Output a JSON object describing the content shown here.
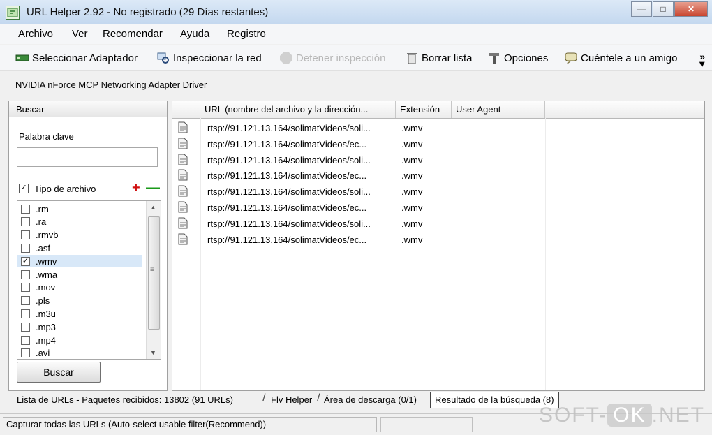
{
  "window": {
    "title": "URL Helper 2.92 - No registrado (29 Días restantes)"
  },
  "menu": [
    "Archivo",
    "Ver",
    "Recomendar",
    "Ayuda",
    "Registro"
  ],
  "toolbar": {
    "select_adapter": "Seleccionar Adaptador",
    "inspect_network": "Inspeccionar la red",
    "stop_inspection": "Detener inspección",
    "clear_list": "Borrar lista",
    "options": "Opciones",
    "tell_friend": "Cuéntele a un amigo"
  },
  "adapter": "NVIDIA nForce MCP Networking Adapter Driver",
  "search_panel": {
    "title": "Buscar",
    "keyword_label": "Palabra clave",
    "keyword_value": "",
    "filetype_label": "Tipo de archivo",
    "filetype_checked": true,
    "extensions": [
      {
        "name": ".rm",
        "checked": false
      },
      {
        "name": ".ra",
        "checked": false
      },
      {
        "name": ".rmvb",
        "checked": false
      },
      {
        "name": ".asf",
        "checked": false
      },
      {
        "name": ".wmv",
        "checked": true
      },
      {
        "name": ".wma",
        "checked": false
      },
      {
        "name": ".mov",
        "checked": false
      },
      {
        "name": ".pls",
        "checked": false
      },
      {
        "name": ".m3u",
        "checked": false
      },
      {
        "name": ".mp3",
        "checked": false
      },
      {
        "name": ".mp4",
        "checked": false
      },
      {
        "name": ".avi",
        "checked": false
      }
    ],
    "search_button": "Buscar"
  },
  "grid": {
    "columns": [
      "URL (nombre del archivo y la dirección...",
      "Extensión",
      "User Agent"
    ],
    "rows": [
      {
        "url": "rtsp://91.121.13.164/solimatVideos/soli...",
        "ext": ".wmv",
        "agent": ""
      },
      {
        "url": "rtsp://91.121.13.164/solimatVideos/ec...",
        "ext": ".wmv",
        "agent": ""
      },
      {
        "url": "rtsp://91.121.13.164/solimatVideos/soli...",
        "ext": ".wmv",
        "agent": ""
      },
      {
        "url": "rtsp://91.121.13.164/solimatVideos/ec...",
        "ext": ".wmv",
        "agent": ""
      },
      {
        "url": "rtsp://91.121.13.164/solimatVideos/soli...",
        "ext": ".wmv",
        "agent": ""
      },
      {
        "url": "rtsp://91.121.13.164/solimatVideos/ec...",
        "ext": ".wmv",
        "agent": ""
      },
      {
        "url": "rtsp://91.121.13.164/solimatVideos/soli...",
        "ext": ".wmv",
        "agent": ""
      },
      {
        "url": "rtsp://91.121.13.164/solimatVideos/ec...",
        "ext": ".wmv",
        "agent": ""
      }
    ]
  },
  "tabs": [
    {
      "label": "Lista de URLs - Paquetes recibidos: 13802 (91 URLs)",
      "active": false
    },
    {
      "label": "Flv Helper",
      "active": false
    },
    {
      "label": "Área de descarga (0/1)",
      "active": false
    },
    {
      "label": "Resultado de la búsqueda (8)",
      "active": true
    }
  ],
  "status": "Capturar todas las URLs (Auto-select usable filter(Recommend))",
  "watermark": {
    "left": "SOFT-",
    "mid": "OK",
    "right": ".NET"
  }
}
